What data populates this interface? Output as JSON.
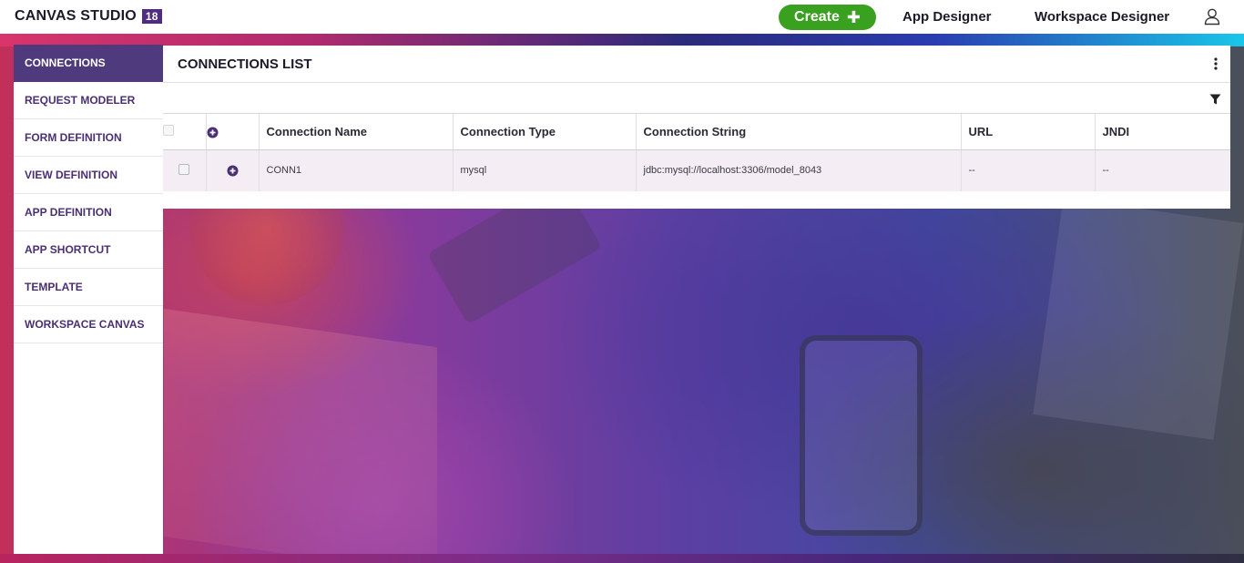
{
  "app": {
    "brand": "CANVAS STUDIO",
    "version_badge": "18",
    "create_label": "Create",
    "nav_app_designer": "App Designer",
    "nav_workspace_designer": "Workspace Designer",
    "user_icon": "user-icon"
  },
  "colors": {
    "brand_purple": "#4f3a7d",
    "create_green": "#3aa020",
    "sidebar_text": "#4a2f72"
  },
  "sidebar": {
    "items": [
      {
        "label": "CONNECTIONS",
        "active": true
      },
      {
        "label": "REQUEST MODELER"
      },
      {
        "label": "FORM DEFINITION"
      },
      {
        "label": "VIEW DEFINITION"
      },
      {
        "label": "APP DEFINITION"
      },
      {
        "label": "APP SHORTCUT"
      },
      {
        "label": "TEMPLATE"
      },
      {
        "label": "WORKSPACE CANVAS"
      }
    ]
  },
  "main": {
    "title": "CONNECTIONS LIST",
    "table": {
      "columns": [
        "Connection Name",
        "Connection Type",
        "Connection String",
        "URL",
        "JNDI"
      ],
      "rows": [
        {
          "name": "CONN1",
          "type": "mysql",
          "string": "jdbc:mysql://localhost:3306/model_8043",
          "url": "--",
          "jndi": "--"
        }
      ]
    }
  }
}
